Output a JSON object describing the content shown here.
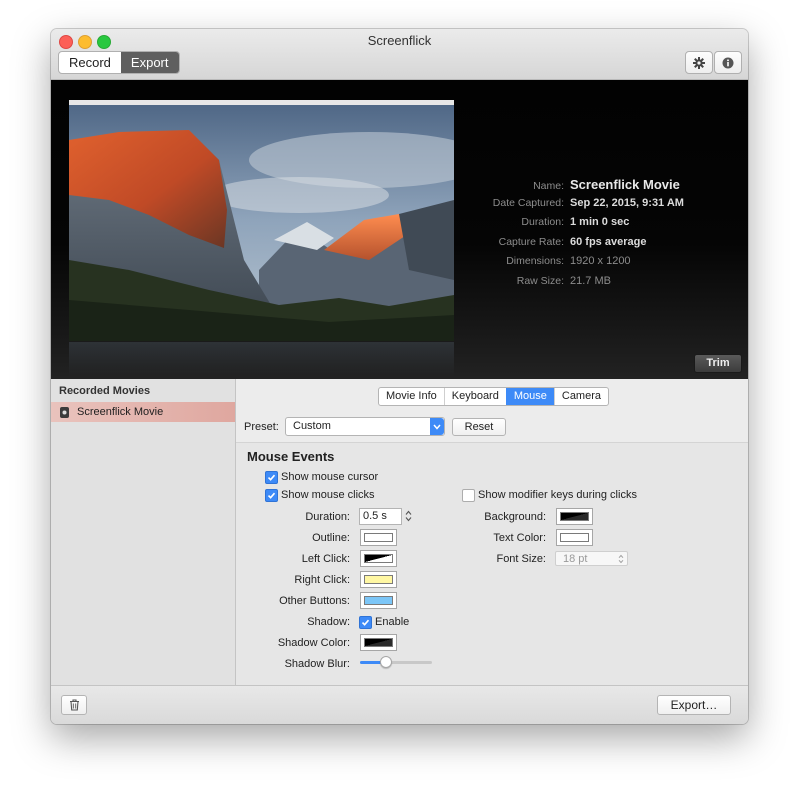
{
  "window": {
    "title": "Screenflick"
  },
  "toolbar": {
    "modes": [
      {
        "label": "Record",
        "active": false
      },
      {
        "label": "Export",
        "active": true
      }
    ],
    "icons": [
      "gear-icon",
      "info-icon"
    ]
  },
  "movie_info": {
    "rows": [
      {
        "label": "Name:",
        "value": "Screenflick Movie"
      },
      {
        "label": "Date Captured:",
        "value": "Sep 22, 2015, 9:31 AM"
      },
      {
        "label": "Duration:",
        "value": "1 min 0 sec"
      },
      {
        "label": "Capture Rate:",
        "value": "60 fps average"
      },
      {
        "label": "Dimensions:",
        "value": "1920 x 1200"
      },
      {
        "label": "Raw Size:",
        "value": "21.7 MB"
      }
    ],
    "trim_label": "Trim"
  },
  "sidebar": {
    "header": "Recorded Movies",
    "items": [
      {
        "label": "Screenflick Movie",
        "selected": true
      }
    ]
  },
  "tabs": [
    {
      "label": "Movie Info",
      "active": false
    },
    {
      "label": "Keyboard",
      "active": false
    },
    {
      "label": "Mouse",
      "active": true
    },
    {
      "label": "Camera",
      "active": false
    }
  ],
  "preset": {
    "label": "Preset:",
    "value": "Custom",
    "reset_label": "Reset"
  },
  "mouse_events": {
    "title": "Mouse Events",
    "show_cursor": {
      "label": "Show mouse cursor",
      "checked": true
    },
    "show_clicks": {
      "label": "Show mouse clicks",
      "checked": true
    },
    "show_modifiers": {
      "label": "Show modifier keys during clicks",
      "checked": false
    },
    "duration": {
      "label": "Duration:",
      "value": "0.5 s"
    },
    "outline": {
      "label": "Outline:",
      "color": "#ffffff"
    },
    "left_click": {
      "label": "Left Click:",
      "color": "#000000"
    },
    "right_click": {
      "label": "Right Click:",
      "color": "#fff7a3"
    },
    "other_buttons": {
      "label": "Other Buttons:",
      "color": "#7cc6f7"
    },
    "shadow": {
      "label": "Shadow:",
      "checkbox_label": "Enable",
      "checked": true
    },
    "shadow_color": {
      "label": "Shadow Color:",
      "color": "#000000"
    },
    "shadow_blur": {
      "label": "Shadow Blur:",
      "value": 0.33
    },
    "background": {
      "label": "Background:",
      "color": "#000000"
    },
    "text_color": {
      "label": "Text Color:",
      "color": "#ffffff"
    },
    "font_size": {
      "label": "Font Size:",
      "value": "18 pt"
    }
  },
  "bottom": {
    "export_label": "Export…"
  },
  "colors": {
    "accent": "#3d8af7",
    "selection": "#e0aaa3"
  }
}
